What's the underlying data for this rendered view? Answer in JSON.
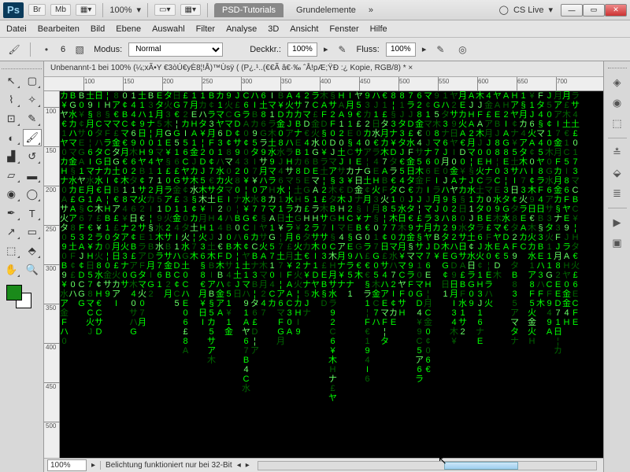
{
  "titlebar": {
    "logo": "Ps",
    "buttons": [
      "Br",
      "Mb"
    ],
    "zoom": "100%",
    "tabs": [
      "PSD-Tutorials",
      "Grundelemente"
    ],
    "cslive": "CS Live"
  },
  "menubar": [
    "Datei",
    "Bearbeiten",
    "Bild",
    "Ebene",
    "Auswahl",
    "Filter",
    "Analyse",
    "3D",
    "Ansicht",
    "Fenster",
    "Hilfe"
  ],
  "optionsbar": {
    "brush_size": "6",
    "modus_label": "Modus:",
    "modus_value": "Normal",
    "deck_label": "Deckkr.:",
    "deck_value": "100%",
    "fluss_label": "Fluss:",
    "fluss_value": "100%"
  },
  "document": {
    "tab_title": "Unbenannt-1 bei 100% (¼;xÃ•Y €3òÚ€yÈ8¦!Å)™Ùsÿ     (  (P¿.¹..(€€Ã â€·‰ ˆÅ!pÆ;ŸÐ :¿ Kopie, RGB/8) * ×"
  },
  "ruler_h": [
    100,
    150,
    200,
    250,
    300,
    350,
    400,
    450,
    500,
    550,
    600,
    650,
    700
  ],
  "ruler_v": [
    100,
    150,
    200,
    250,
    300,
    350,
    400,
    450,
    500
  ],
  "status": {
    "zoom": "100%",
    "message": "Belichtung funktioniert nur bei 32-Bit"
  },
  "colors": {
    "fg": "#1a8a1a",
    "bg": "#ffffff"
  }
}
